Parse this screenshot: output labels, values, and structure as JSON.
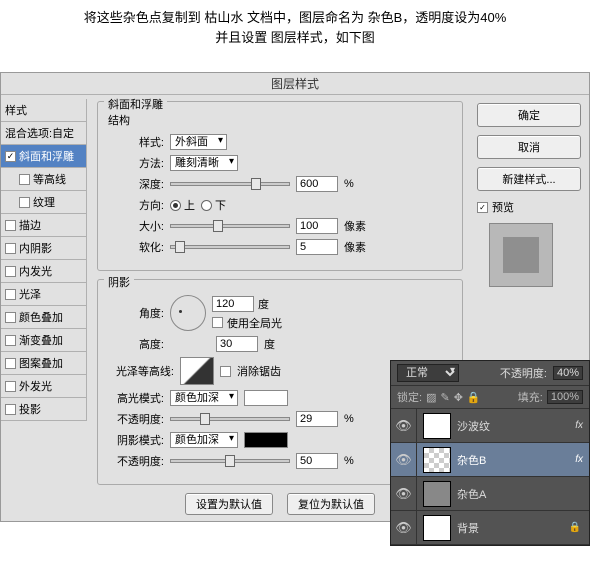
{
  "instructions": {
    "line1": "将这些杂色点复制到 枯山水 文档中，图层命名为 杂色B，透明度设为40%",
    "line2": "并且设置 图层样式，如下图"
  },
  "dialog": {
    "title": "图层样式",
    "styles_header": "样式",
    "blend_options": "混合选项:自定",
    "items": [
      {
        "label": "斜面和浮雕",
        "checked": true,
        "selected": true,
        "indent": 0
      },
      {
        "label": "等高线",
        "checked": false,
        "indent": 1
      },
      {
        "label": "纹理",
        "checked": false,
        "indent": 1
      },
      {
        "label": "描边",
        "checked": false,
        "indent": 0
      },
      {
        "label": "内阴影",
        "checked": false,
        "indent": 0
      },
      {
        "label": "内发光",
        "checked": false,
        "indent": 0
      },
      {
        "label": "光泽",
        "checked": false,
        "indent": 0
      },
      {
        "label": "颜色叠加",
        "checked": false,
        "indent": 0
      },
      {
        "label": "渐变叠加",
        "checked": false,
        "indent": 0
      },
      {
        "label": "图案叠加",
        "checked": false,
        "indent": 0
      },
      {
        "label": "外发光",
        "checked": false,
        "indent": 0
      },
      {
        "label": "投影",
        "checked": false,
        "indent": 0
      }
    ],
    "bevel": {
      "legend": "斜面和浮雕",
      "structure": "结构",
      "style_label": "样式:",
      "style_value": "外斜面",
      "technique_label": "方法:",
      "technique_value": "雕刻清晰",
      "depth_label": "深度:",
      "depth_value": "600",
      "percent": "%",
      "direction_label": "方向:",
      "up": "上",
      "down": "下",
      "size_label": "大小:",
      "size_value": "100",
      "px": "像素",
      "soften_label": "软化:",
      "soften_value": "5"
    },
    "shading": {
      "legend": "阴影",
      "angle_label": "角度:",
      "angle_value": "120",
      "deg": "度",
      "global_light": "使用全局光",
      "altitude_label": "高度:",
      "altitude_value": "30",
      "gloss_label": "光泽等高线:",
      "antialias": "消除锯齿",
      "highlight_mode_label": "高光模式:",
      "highlight_mode_value": "颜色加深",
      "opacity_label": "不透明度:",
      "highlight_opacity": "29",
      "shadow_mode_label": "阴影模式:",
      "shadow_mode_value": "颜色加深",
      "shadow_opacity": "50"
    },
    "buttons": {
      "default_set": "设置为默认值",
      "default_reset": "复位为默认值",
      "ok": "确定",
      "cancel": "取消",
      "new_style": "新建样式...",
      "preview": "预览"
    }
  },
  "layers": {
    "blend_mode": "正常",
    "opacity_label": "不透明度:",
    "opacity_value": "40%",
    "lock_label": "锁定:",
    "fill_label": "填充:",
    "fill_value": "100%",
    "rows": [
      {
        "name": "沙波纹",
        "fx": true
      },
      {
        "name": "杂色B",
        "fx": true,
        "selected": true
      },
      {
        "name": "杂色A"
      },
      {
        "name": "背景",
        "locked": true
      }
    ]
  }
}
